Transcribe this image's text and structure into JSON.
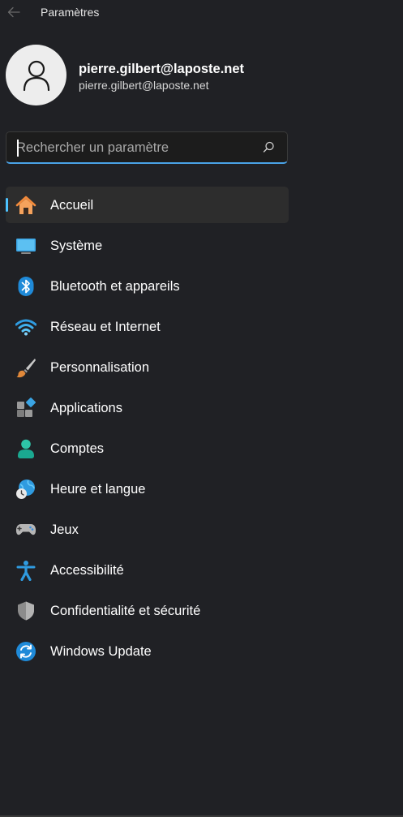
{
  "titlebar": {
    "title": "Paramètres",
    "back_icon": "arrow-left-icon"
  },
  "profile": {
    "name": "pierre.gilbert@laposte.net",
    "email": "pierre.gilbert@laposte.net",
    "avatar_icon": "user-avatar-icon"
  },
  "search": {
    "placeholder": "Rechercher un paramètre",
    "value": "",
    "icon": "search-icon",
    "accent_color": "#4aa3e8"
  },
  "nav": {
    "selected": "Accueil",
    "accent_color": "#4cc2ff",
    "items": [
      {
        "label": "Accueil",
        "icon": "home-icon"
      },
      {
        "label": "Système",
        "icon": "monitor-icon"
      },
      {
        "label": "Bluetooth et appareils",
        "icon": "bluetooth-icon"
      },
      {
        "label": "Réseau et Internet",
        "icon": "wifi-icon"
      },
      {
        "label": "Personnalisation",
        "icon": "paintbrush-icon"
      },
      {
        "label": "Applications",
        "icon": "apps-icon"
      },
      {
        "label": "Comptes",
        "icon": "account-icon"
      },
      {
        "label": "Heure et langue",
        "icon": "globe-clock-icon"
      },
      {
        "label": "Jeux",
        "icon": "gamepad-icon"
      },
      {
        "label": "Accessibilité",
        "icon": "accessibility-icon"
      },
      {
        "label": "Confidentialité et sécurité",
        "icon": "shield-icon"
      },
      {
        "label": "Windows Update",
        "icon": "windows-update-icon"
      }
    ]
  }
}
